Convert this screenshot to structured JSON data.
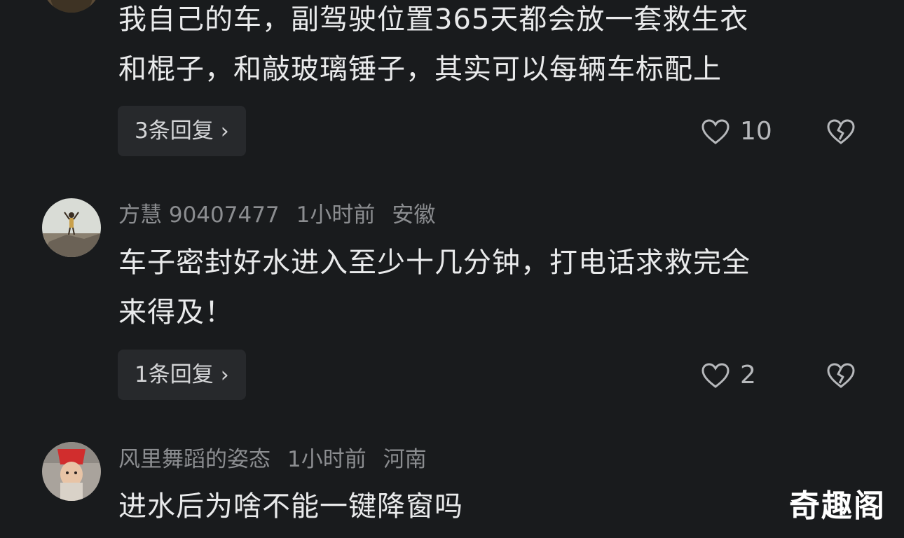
{
  "comments": [
    {
      "text_lines": [
        "我自己的车，副驾驶位置365天都会放一套救生衣",
        "和棍子，和敲玻璃锤子，其实可以每辆车标配上"
      ],
      "reply_label": "3条回复",
      "likes": "10"
    },
    {
      "author": "方慧 90407477",
      "time": "1小时前",
      "location": "安徽",
      "text_lines": [
        "车子密封好水进入至少十几分钟，打电话求救完全",
        "来得及！"
      ],
      "reply_label": "1条回复",
      "likes": "2"
    },
    {
      "author": "风里舞蹈的姿态",
      "time": "1小时前",
      "location": "河南",
      "text_lines": [
        "进水后为啥不能一键降窗吗"
      ]
    }
  ],
  "icons": {
    "like": "heart-outline-icon",
    "dislike": "broken-heart-icon",
    "chevron": "chevron-right-icon"
  },
  "watermark": "奇趣阁",
  "colors": {
    "background": "#191b1d",
    "text": "#e9eaeb",
    "meta": "#8b8d90",
    "button_bg": "#27292c"
  }
}
